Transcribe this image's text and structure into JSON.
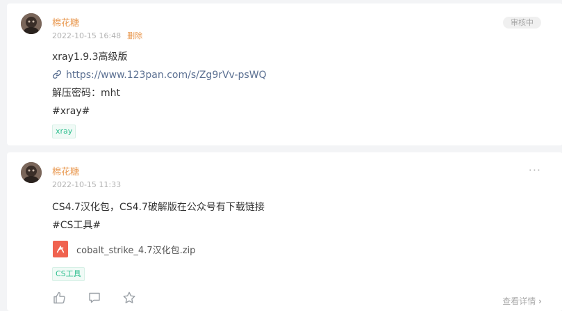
{
  "posts": [
    {
      "author": "棉花糖",
      "timestamp": "2022-10-15 16:48",
      "delete_label": "删除",
      "status_badge": "审核中",
      "lines": [
        "xray1.9.3高级版",
        "解压密码：mht",
        "#xray#"
      ],
      "link_text": "https://www.123pan.com/s/Zg9rVv-psWQ",
      "tag": "xray"
    },
    {
      "author": "棉花糖",
      "timestamp": "2022-10-15 11:33",
      "lines": [
        "CS4.7汉化包，CS4.7破解版在公众号有下载链接",
        "#CS工具#"
      ],
      "attachment": "cobalt_strike_4.7汉化包.zip",
      "tag": "CS工具",
      "more_label": "···",
      "detail_link": "查看详情",
      "detail_chevron": "›"
    }
  ],
  "icons": {
    "like": "thumbs-up-icon",
    "comment": "comment-icon",
    "favorite": "star-icon",
    "link": "link-icon",
    "file": "file-icon"
  }
}
